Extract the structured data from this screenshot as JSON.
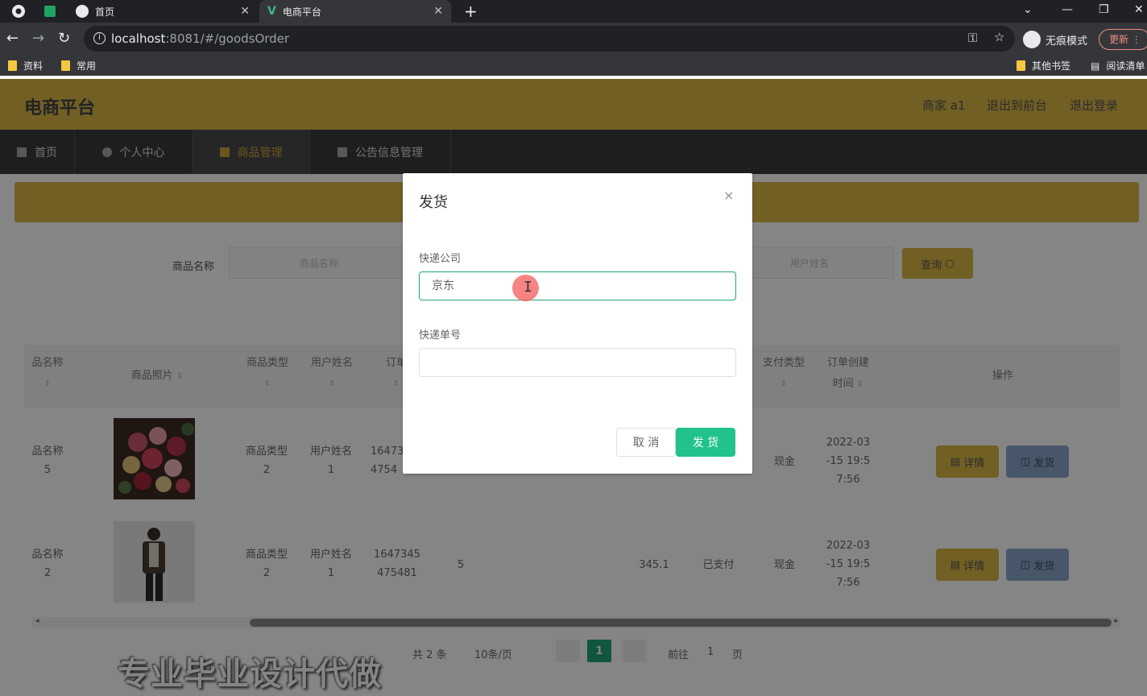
{
  "browser": {
    "tabs": [
      {
        "title": "首页",
        "active": false
      },
      {
        "title": "电商平台",
        "active": true
      }
    ],
    "new_tab": "+",
    "url_host": "localhost",
    "url_path": ":8081/#/goodsOrder",
    "incognito_label": "无痕模式",
    "update_label": "更新",
    "bookmarks": [
      "资料",
      "常用"
    ],
    "bookmarks_right": [
      "其他书签",
      "阅读清单"
    ]
  },
  "app": {
    "title": "电商平台",
    "header_links": [
      "商家 a1",
      "退出到前台",
      "退出登录"
    ],
    "menu": [
      {
        "label": "首页",
        "active": false
      },
      {
        "label": "个人中心",
        "active": false
      },
      {
        "label": "商品管理",
        "active": true
      },
      {
        "label": "公告信息管理",
        "active": false
      }
    ]
  },
  "search": {
    "goods_name_label": "商品名称",
    "goods_name_placeholder": "商品名称",
    "user_name_placeholder": "用户姓名",
    "query_button": "查询"
  },
  "table": {
    "headers": {
      "goods_name": "品名称",
      "goods_photo": "商品照片",
      "goods_type": "商品类型",
      "user_name": "用户姓名",
      "order_no": "订单",
      "pay_type": "支付类型",
      "created_line1": "订单创建",
      "created_line2": "时间",
      "actions": "操作"
    },
    "rows": [
      {
        "goods_name_1": "品名称",
        "goods_name_2": "5",
        "type_1": "商品类型",
        "type_2": "2",
        "user_1": "用户姓名",
        "user_2": "1",
        "order_1": "16473",
        "order_2": "4754",
        "qty": "",
        "price": "",
        "status": "",
        "pay": "现金",
        "date_1": "2022-03",
        "date_2": "-15 19:5",
        "date_3": "7:56"
      },
      {
        "goods_name_1": "品名称",
        "goods_name_2": "2",
        "type_1": "商品类型",
        "type_2": "2",
        "user_1": "用户姓名",
        "user_2": "1",
        "order_1": "1647345",
        "order_2": "475481",
        "qty": "5",
        "price": "345.1",
        "status": "已支付",
        "pay": "现金",
        "date_1": "2022-03",
        "date_2": "-15 19:5",
        "date_3": "7:56"
      }
    ],
    "detail_btn": "详情",
    "ship_btn": "发货"
  },
  "pagination": {
    "total": "共 2 条",
    "page_size": "10条/页",
    "current": "1",
    "goto_prefix": "前往",
    "goto_value": "1",
    "goto_suffix": "页"
  },
  "watermark": "专业毕业设计代做",
  "dialog": {
    "title": "发货",
    "close": "×",
    "company_label": "快递公司",
    "company_value": "京东",
    "number_label": "快递单号",
    "number_value": "",
    "cancel": "取 消",
    "confirm": "发 货"
  },
  "colors": {
    "accent": "#d8b645",
    "primary": "#21c28c"
  }
}
